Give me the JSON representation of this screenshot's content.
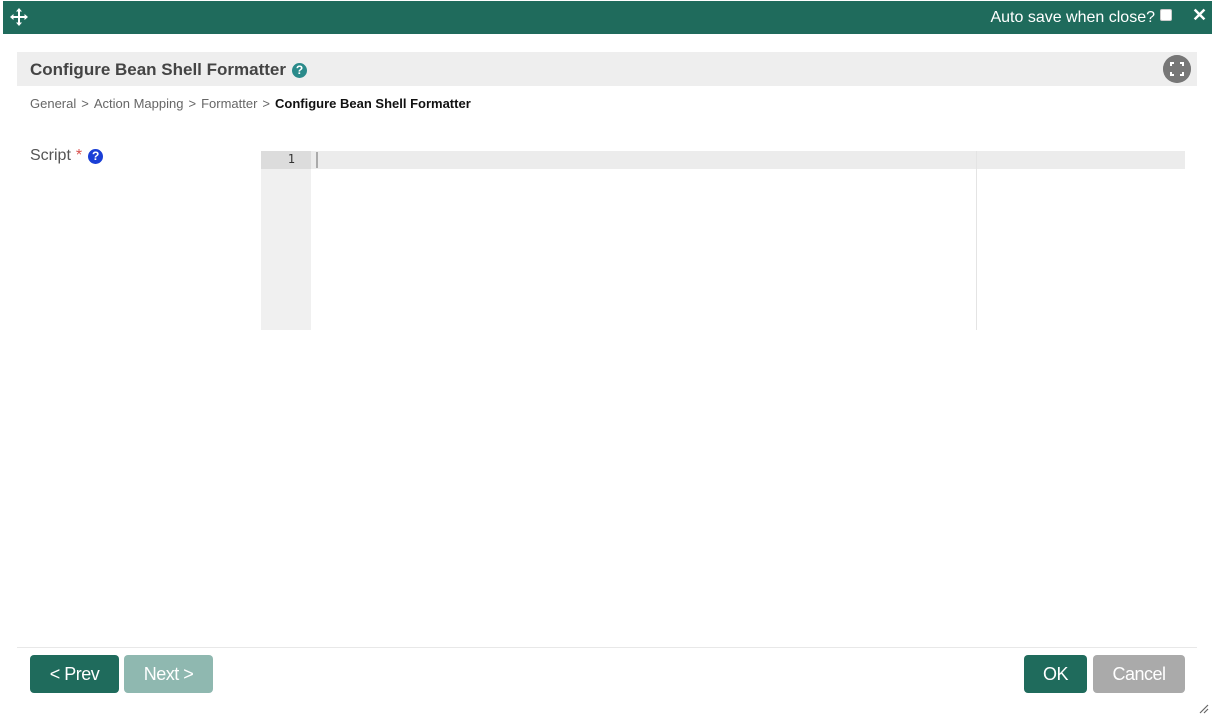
{
  "titlebar": {
    "autosave_label": "Auto save when close?",
    "autosave_checked": false,
    "close_glyph": "✕",
    "bg_color": "#1f6b5c"
  },
  "header": {
    "title": "Configure Bean Shell Formatter",
    "help_glyph": "?"
  },
  "breadcrumb": {
    "items": [
      "General",
      "Action Mapping",
      "Formatter"
    ],
    "separator": ">",
    "current": "Configure Bean Shell Formatter"
  },
  "form": {
    "script_label": "Script",
    "required_mark": "*",
    "help_glyph": "?",
    "editor": {
      "line_numbers": [
        "1"
      ],
      "content": ""
    }
  },
  "footer": {
    "prev_label": "< Prev",
    "next_label": "Next >",
    "ok_label": "OK",
    "cancel_label": "Cancel"
  },
  "icons": {
    "move": "move-icon",
    "close": "close-icon",
    "help": "question-circle-icon",
    "maximize": "expand-icon",
    "resize": "resize-grip-icon"
  },
  "colors": {
    "primary": "#1f6b5c",
    "primary_disabled": "#8fb8b0",
    "cancel": "#aaaaaa",
    "required": "#d9534f",
    "help_blue": "#1a3fd6",
    "help_teal": "#2a8a8a"
  }
}
